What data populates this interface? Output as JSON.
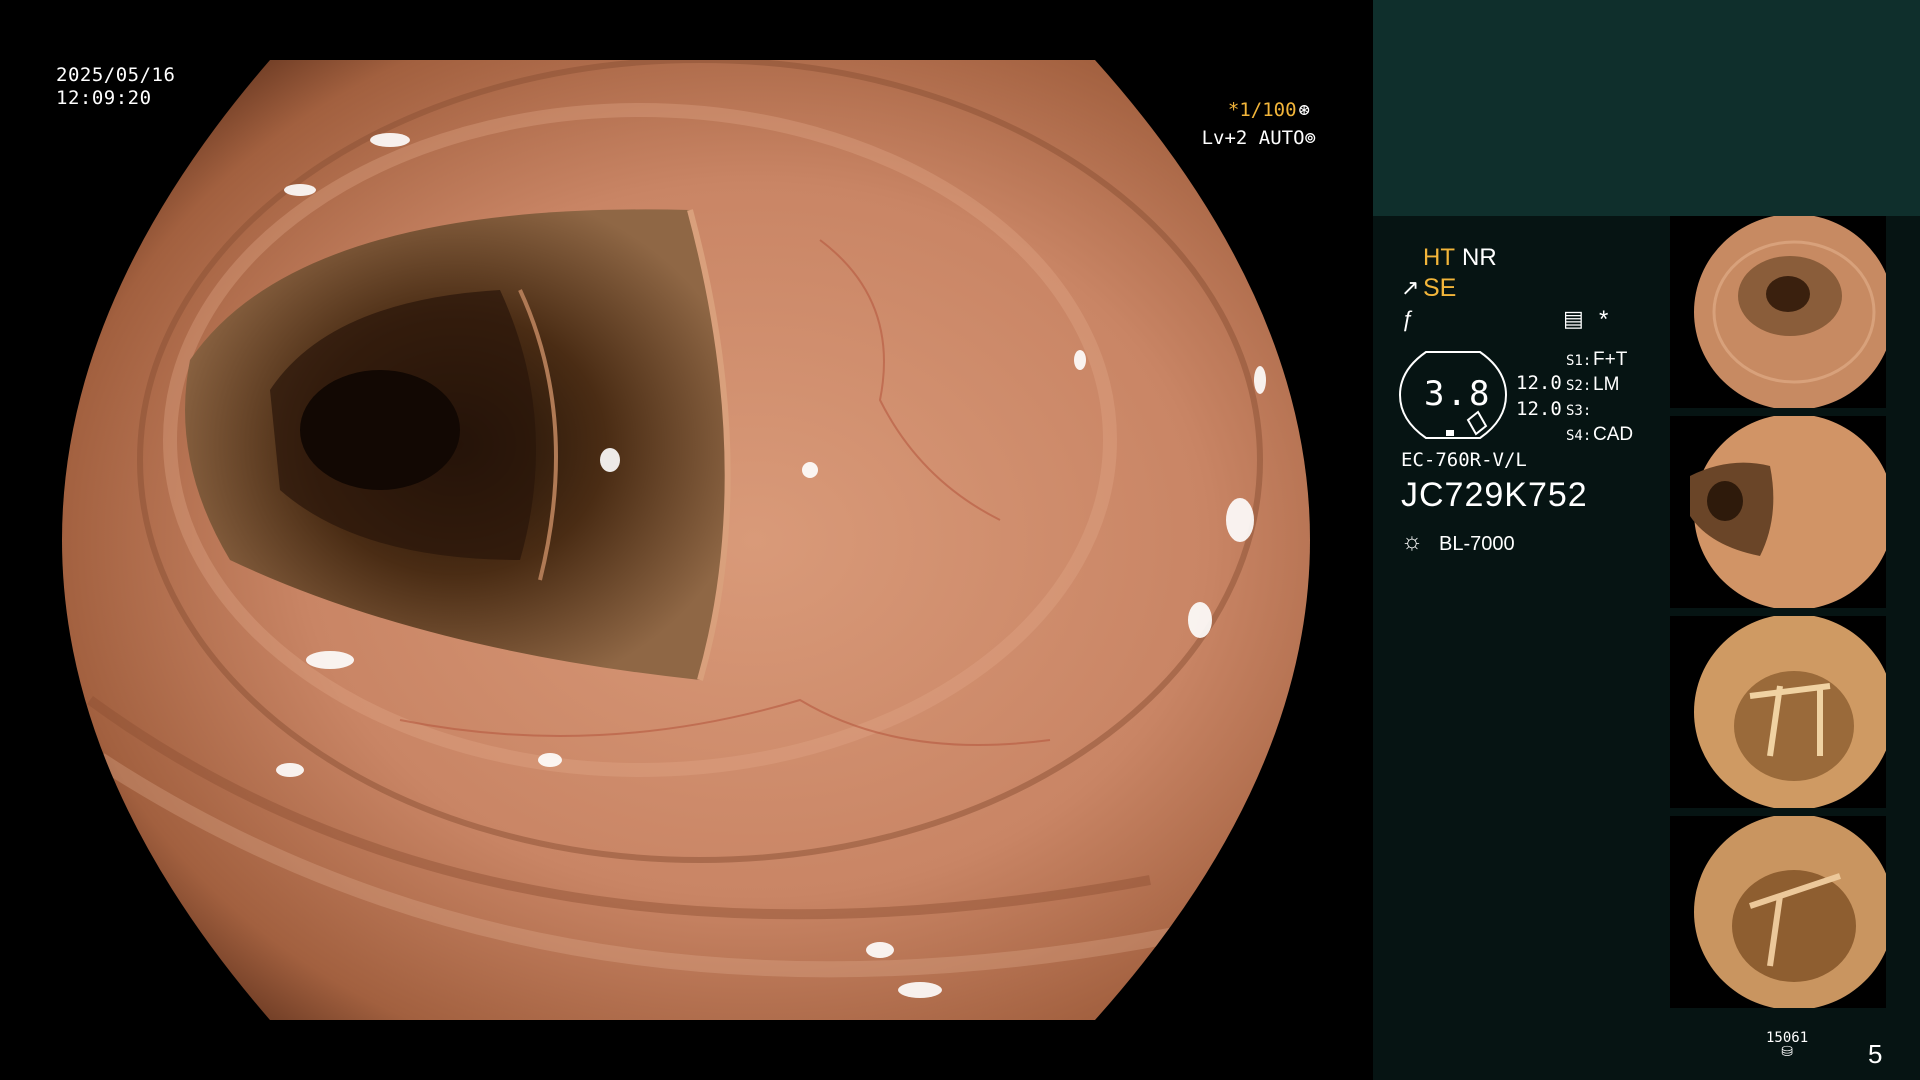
{
  "main_view": {
    "date": "2025/05/16",
    "time": "12:09:20",
    "shutter": "*1/100",
    "shutter_icon": "aperture-icon",
    "level": "Lv+2 AUTO",
    "level_icon": "iris-icon"
  },
  "panel": {
    "ht": "HT",
    "nr": "NR",
    "se": "SE",
    "se_icon": "structure-enhance-icon",
    "struct_icon": "edge-enhance-icon",
    "memo_icon": "memo-icon",
    "asterisk": "*",
    "zoom_value": "3.8",
    "value_a": "12.0",
    "value_b": "12.0",
    "switches": [
      {
        "key": "S1:",
        "value": "F+T"
      },
      {
        "key": "S2:",
        "value": "LM"
      },
      {
        "key": "S3:",
        "value": ""
      },
      {
        "key": "S4:",
        "value": "CAD"
      }
    ],
    "scope_model": "EC-760R-V/L",
    "scope_serial": "JC729K752",
    "light_source": "BL-7000",
    "light_icon": "light-source-icon",
    "image_count": "15061",
    "page_number": "5"
  },
  "colors": {
    "accent_yellow": "#f2b53a",
    "panel_dark": "#061413",
    "panel_header": "#0f2f2c"
  }
}
